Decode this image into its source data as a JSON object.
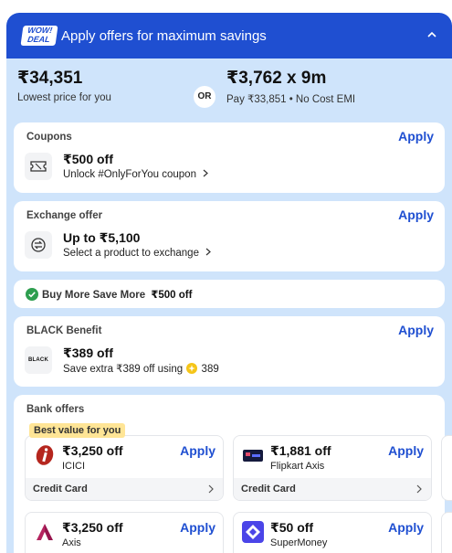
{
  "header": {
    "logo_line1": "WOW!",
    "logo_line2": "DEAL",
    "title": "Apply offers for maximum savings"
  },
  "price": {
    "lowest_amount": "₹34,351",
    "lowest_label": "Lowest price for you",
    "or_label": "OR",
    "emi_amount": "₹3,762 x 9m",
    "emi_label": "Pay ₹33,851 • No Cost EMI"
  },
  "coupons": {
    "title": "Coupons",
    "apply": "Apply",
    "amount": "₹500 off",
    "desc": "Unlock #OnlyForYou coupon"
  },
  "exchange": {
    "title": "Exchange offer",
    "apply": "Apply",
    "amount": "Up to ₹5,100",
    "desc": "Select a product to exchange"
  },
  "buy_more": {
    "label": "Buy More Save More",
    "amount": "₹500 off"
  },
  "black": {
    "title": "BLACK Benefit",
    "apply": "Apply",
    "amount": "₹389 off",
    "desc_prefix": "Save extra ₹389 off using",
    "coin_value": "389",
    "logo_text": "BLACK"
  },
  "bank": {
    "title": "Bank offers",
    "best_tag": "Best value for you",
    "cards": [
      {
        "amount": "₹3,250 off",
        "bank": "ICICI",
        "apply": "Apply",
        "footer": "Credit Card"
      },
      {
        "amount": "₹1,881 off",
        "bank": "Flipkart Axis",
        "apply": "Apply",
        "footer": "Credit Card"
      },
      {
        "amount": "₹3,250 off",
        "bank": "Axis",
        "apply": "Apply"
      },
      {
        "amount": "₹50 off",
        "bank": "SuperMoney",
        "apply": "Apply"
      }
    ]
  },
  "colors": {
    "brand_blue": "#1f4fd1",
    "panel_bg": "#cfe4fb",
    "success_green": "#2e9e4f",
    "tag_yellow": "#ffe596"
  }
}
